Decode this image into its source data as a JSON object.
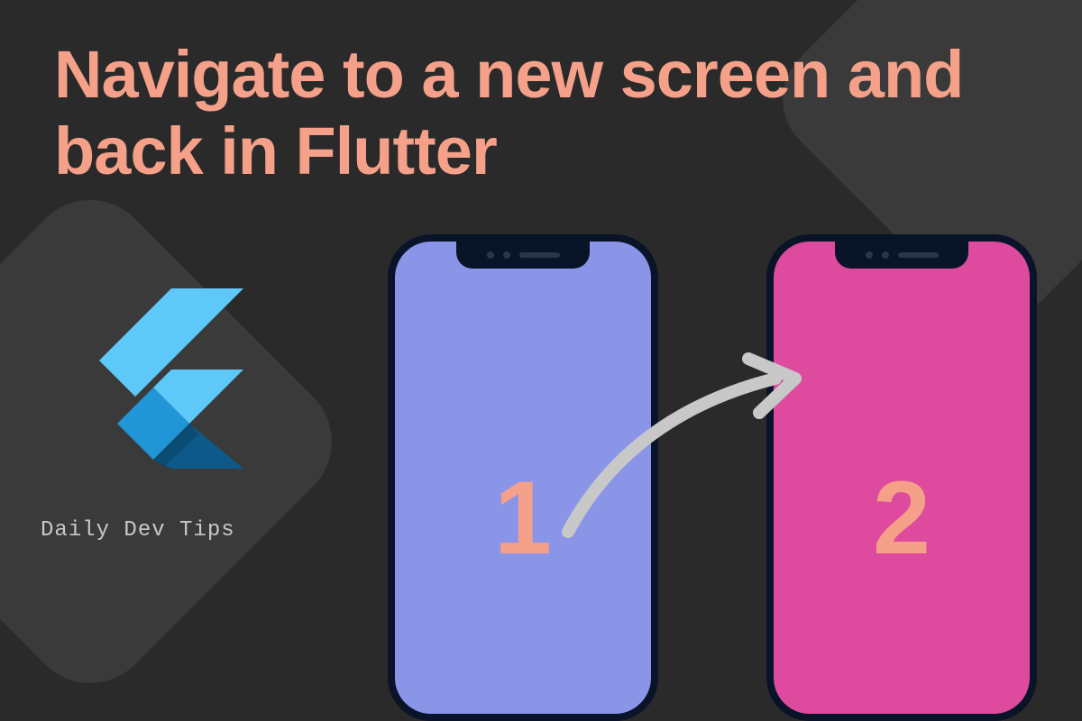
{
  "title": "Navigate to a new screen and back in Flutter",
  "footer": "Daily Dev Tips",
  "phones": {
    "one": {
      "label": "1",
      "screen_color": "#8a95e8"
    },
    "two": {
      "label": "2",
      "screen_color": "#dd4a9e"
    }
  },
  "colors": {
    "background": "#2a2a2a",
    "title": "#f5a088",
    "accent_shape": "#3a3a3a",
    "phone_frame": "#0a1428"
  }
}
